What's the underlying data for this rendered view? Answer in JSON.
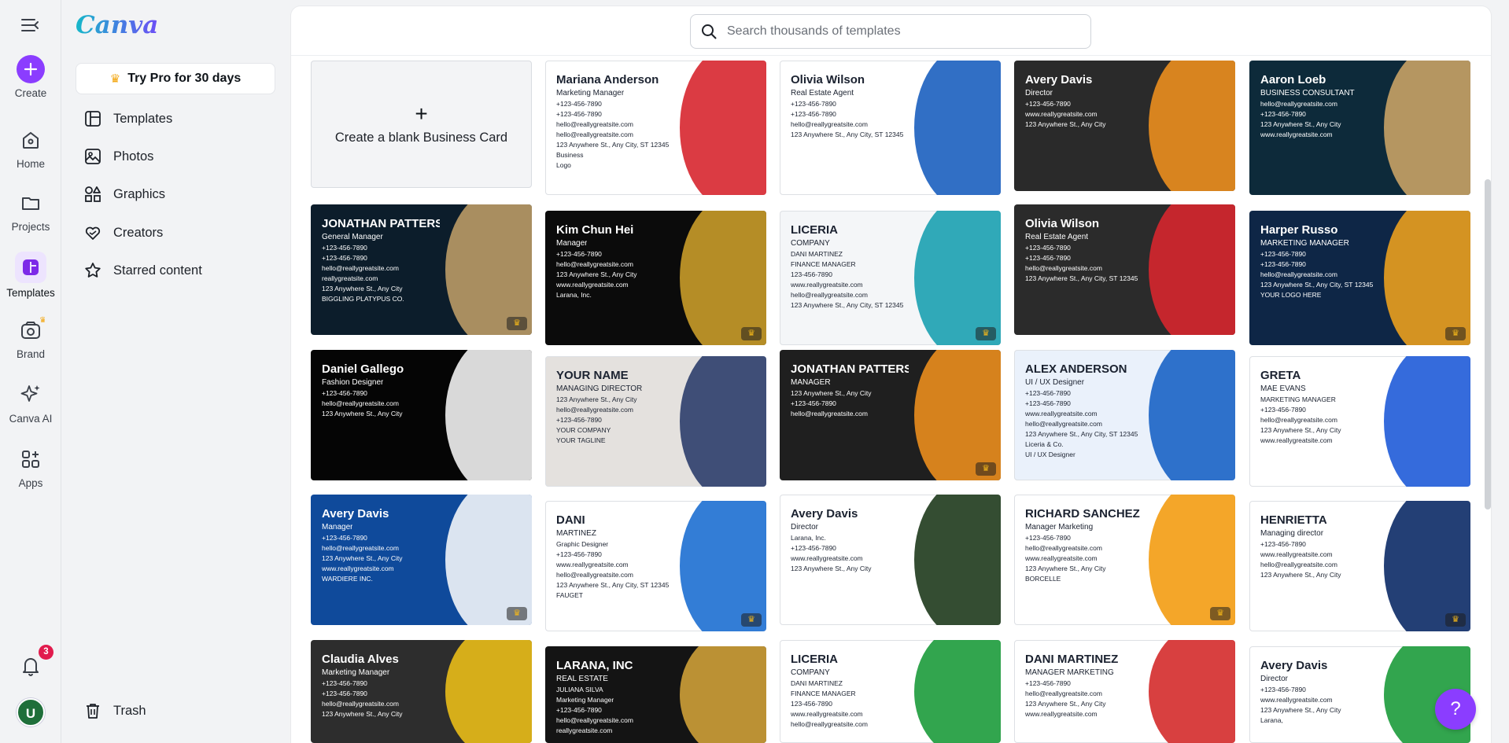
{
  "app": {
    "brand": "Canva"
  },
  "rail": {
    "create": "Create",
    "home": "Home",
    "projects": "Projects",
    "templates": "Templates",
    "brand": "Brand",
    "canva_ai": "Canva AI",
    "apps": "Apps",
    "notifications_count": "3",
    "avatar_letter": "U"
  },
  "panel": {
    "pro_button": "Try Pro for 30 days",
    "items": [
      {
        "label": "Templates",
        "icon": "template-icon"
      },
      {
        "label": "Photos",
        "icon": "photo-icon"
      },
      {
        "label": "Graphics",
        "icon": "graphics-icon"
      },
      {
        "label": "Creators",
        "icon": "creators-icon"
      },
      {
        "label": "Starred content",
        "icon": "star-icon"
      }
    ],
    "trash": "Trash"
  },
  "search": {
    "placeholder": "Search thousands of templates"
  },
  "blank_card": {
    "label": "Create a blank Business Card"
  },
  "colors": {
    "accent": "#8b3dff",
    "badge": "#e11b4d"
  },
  "cards": [
    {
      "id": "c1",
      "bg": "#ffffff",
      "accent": "#d7262f",
      "lines": [
        "Mariana Anderson",
        "Marketing Manager",
        "+123-456-7890",
        "+123-456-7890",
        "hello@reallygreatsite.com",
        "hello@reallygreatsite.com",
        "123 Anywhere St., Any City, ST 12345",
        "Business",
        "Logo"
      ],
      "pro": false
    },
    {
      "id": "c2",
      "bg": "#ffffff",
      "accent": "#1b5fbf",
      "lines": [
        "Olivia Wilson",
        "Real Estate Agent",
        "+123-456-7890",
        "+123-456-7890",
        "hello@reallygreatsite.com",
        "123 Anywhere St., Any City, ST 12345"
      ],
      "pro": false
    },
    {
      "id": "c3",
      "bg": "#2a2a2a",
      "accent": "#f7941d",
      "lines": [
        "Avery Davis",
        "Director",
        "+123-456-7890",
        "www.reallygreatsite.com",
        "123 Anywhere St., Any City"
      ],
      "pro": false
    },
    {
      "id": "c4",
      "bg": "#0d2a3a",
      "accent": "#d3a968",
      "lines": [
        "Aaron Loeb",
        "BUSINESS CONSULTANT",
        "hello@reallygreatsite.com",
        "+123-456-7890",
        "123 Anywhere St., Any City",
        "www.reallygreatsite.com"
      ],
      "pro": false
    },
    {
      "id": "c5",
      "bg": "#0c1d2b",
      "accent": "#c6a26a",
      "lines": [
        "JONATHAN PATTERSON",
        "General Manager",
        "+123-456-7890",
        "+123-456-7890",
        "hello@reallygreatsite.com",
        "reallygreatsite.com",
        "123 Anywhere St., Any City",
        "BIGGLING PLATYPUS CO."
      ],
      "pro": true
    },
    {
      "id": "c6",
      "bg": "#0b0b0b",
      "accent": "#d4a42c",
      "lines": [
        "Kim Chun Hei",
        "Manager",
        "+123-456-7890",
        "hello@reallygreatsite.com",
        "123 Anywhere St., Any City",
        "www.reallygreatsite.com",
        "Larana, Inc."
      ],
      "pro": true
    },
    {
      "id": "c7",
      "bg": "#f4f6f8",
      "accent": "#1ba1b0",
      "lines": [
        "LICERIA",
        "COMPANY",
        "DANI MARTINEZ",
        "FINANCE MANAGER",
        "123-456-7890",
        "www.reallygreatsite.com",
        "hello@reallygreatsite.com",
        "123 Anywhere St., Any City, ST 12345"
      ],
      "pro": true
    },
    {
      "id": "c8",
      "bg": "#2b2b2b",
      "accent": "#e0262e",
      "lines": [
        "Olivia Wilson",
        "Real Estate Agent",
        "+123-456-7890",
        "+123-456-7890",
        "hello@reallygreatsite.com",
        "123 Anywhere St., Any City, ST 12345"
      ],
      "pro": false
    },
    {
      "id": "c9",
      "bg": "#0e2646",
      "accent": "#f7a71c",
      "lines": [
        "Harper Russo",
        "MARKETING MANAGER",
        "+123-456-7890",
        "+123-456-7890",
        "hello@reallygreatsite.com",
        "123 Anywhere St., Any City, ST 12345",
        "YOUR LOGO HERE"
      ],
      "pro": true
    },
    {
      "id": "c10",
      "bg": "#050505",
      "accent": "#ffffff",
      "lines": [
        "Daniel Gallego",
        "Fashion Designer",
        "+123-456-7890",
        "hello@reallygreatsite.com",
        "123 Anywhere St., Any City"
      ],
      "pro": false
    },
    {
      "id": "c11",
      "bg": "#e4e1de",
      "accent": "#2c3e6b",
      "lines": [
        "YOUR NAME",
        "MANAGING DIRECTOR",
        "123 Anywhere St., Any City",
        "hello@reallygreatsite.com",
        "+123-456-7890",
        "YOUR COMPANY",
        "YOUR TAGLINE"
      ],
      "pro": false
    },
    {
      "id": "c12",
      "bg": "#1f1f1f",
      "accent": "#f7941d",
      "lines": [
        "JONATHAN PATTERSON",
        "MANAGER",
        "123 Anywhere St., Any City",
        "+123-456-7890",
        "hello@reallygreatsite.com"
      ],
      "pro": true
    },
    {
      "id": "c13",
      "bg": "#eaf1fb",
      "accent": "#1a63c5",
      "lines": [
        "ALEX ANDERSON",
        "UI / UX Designer",
        "+123-456-7890",
        "+123-456-7890",
        "www.reallygreatsite.com",
        "hello@reallygreatsite.com",
        "123 Anywhere St., Any City, ST 12345",
        "Liceria & Co.",
        "UI / UX Designer"
      ],
      "pro": false
    },
    {
      "id": "c14",
      "bg": "#ffffff",
      "accent": "#1f5bd8",
      "lines": [
        "GRETA",
        "MAE EVANS",
        "MARKETING MANAGER",
        "+123-456-7890",
        "hello@reallygreatsite.com",
        "123 Anywhere St., Any City",
        "www.reallygreatsite.com"
      ],
      "pro": false
    },
    {
      "id": "c15",
      "bg": "#0f4a9b",
      "accent": "#ffffff",
      "lines": [
        "Avery Davis",
        "Manager",
        "+123-456-7890",
        "hello@reallygreatsite.com",
        "123 Anywhere St., Any City",
        "www.reallygreatsite.com",
        "WARDIERE INC."
      ],
      "pro": true
    },
    {
      "id": "c16",
      "bg": "#ffffff",
      "accent": "#1d6fd1",
      "lines": [
        "DANI",
        "MARTINEZ",
        "Graphic Designer",
        "+123-456-7890",
        "www.reallygreatsite.com",
        "hello@reallygreatsite.com",
        "123 Anywhere St., Any City, ST 12345",
        "FAUGET"
      ],
      "pro": true
    },
    {
      "id": "c17",
      "bg": "#ffffff",
      "accent": "#1e3a1c",
      "lines": [
        "Avery Davis",
        "Director",
        "Larana, Inc.",
        "+123-456-7890",
        "www.reallygreatsite.com",
        "123 Anywhere St., Any City"
      ],
      "pro": false
    },
    {
      "id": "c18",
      "bg": "#ffffff",
      "accent": "#f39c12",
      "lines": [
        "RICHARD SANCHEZ",
        "Manager Marketing",
        "+123-456-7890",
        "hello@reallygreatsite.com",
        "www.reallygreatsite.com",
        "123 Anywhere St., Any City",
        "BORCELLE"
      ],
      "pro": true
    },
    {
      "id": "c19",
      "bg": "#ffffff",
      "accent": "#0b2a66",
      "lines": [
        "HENRIETTA",
        "Managing director",
        "+123-456-7890",
        "www.reallygreatsite.com",
        "hello@reallygreatsite.com",
        "123 Anywhere St., Any City"
      ],
      "pro": true
    },
    {
      "id": "c20",
      "bg": "#2d2d2d",
      "accent": "#f5c518",
      "lines": [
        "Claudia Alves",
        "Marketing Manager",
        "+123-456-7890",
        "+123-456-7890",
        "hello@reallygreatsite.com",
        "123 Anywhere St., Any City"
      ],
      "pro": false
    },
    {
      "id": "c21",
      "bg": "#141414",
      "accent": "#d8a73a",
      "lines": [
        "LARANA, INC",
        "REAL ESTATE",
        "JULIANA SILVA",
        "Marketing Manager",
        "+123-456-7890",
        "hello@reallygreatsite.com",
        "reallygreatsite.com"
      ],
      "pro": false
    },
    {
      "id": "c22",
      "bg": "#ffffff",
      "accent": "#1c9b3b",
      "lines": [
        "LICERIA",
        "COMPANY",
        "DANI MARTINEZ",
        "FINANCE MANAGER",
        "123-456-7890",
        "www.reallygreatsite.com",
        "hello@reallygreatsite.com"
      ],
      "pro": false
    },
    {
      "id": "c23",
      "bg": "#ffffff",
      "accent": "#d42b2b",
      "lines": [
        "DANI MARTINEZ",
        "MANAGER MARKETING",
        "+123-456-7890",
        "hello@reallygreatsite.com",
        "123 Anywhere St., Any City",
        "www.reallygreatsite.com"
      ],
      "pro": false
    },
    {
      "id": "c24",
      "bg": "#ffffff",
      "accent": "#1c9b3b",
      "lines": [
        "Avery Davis",
        "Director",
        "+123-456-7890",
        "www.reallygreatsite.com",
        "123 Anywhere St., Any City",
        "Larana,"
      ],
      "pro": false
    }
  ],
  "help": {
    "label": "?"
  }
}
